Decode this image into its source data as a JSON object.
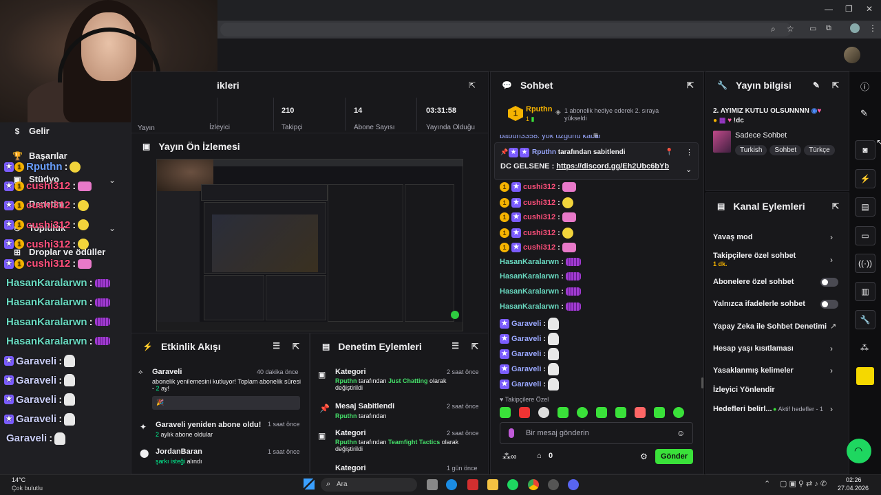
{
  "leftnav": {
    "gelir": "Gelir",
    "basarilar": "Başarılar",
    "studyo": "Stüdyo",
    "denetim": "Denetim",
    "topluluk": "Topluluk",
    "droplar": "Droplar ve ödüller"
  },
  "overlay_chat": [
    {
      "name": "Rputhn",
      "badges": [
        "star",
        "gold"
      ],
      "emote": "em-yellow",
      "color": "#6aa0ff"
    },
    {
      "name": "cushi312",
      "badges": [
        "star",
        "gold"
      ],
      "emote": "em-fish",
      "color": "#ff4f7b"
    },
    {
      "name": "cushi312",
      "badges": [
        "star",
        "gold"
      ],
      "emote": "em-yellow",
      "color": "#ff4f7b"
    },
    {
      "name": "cushi312",
      "badges": [
        "star",
        "gold"
      ],
      "emote": "em-yellow",
      "color": "#ff4f7b"
    },
    {
      "name": "cushi312",
      "badges": [
        "star",
        "gold"
      ],
      "emote": "em-yellow",
      "color": "#ff4f7b"
    },
    {
      "name": "cushi312",
      "badges": [
        "star",
        "gold"
      ],
      "emote": "em-fish",
      "color": "#ff4f7b"
    },
    {
      "name": "HasanKaralarwn",
      "badges": [],
      "emote": "em-grid",
      "color": "#69d9c0"
    },
    {
      "name": "HasanKaralarwn",
      "badges": [],
      "emote": "em-grid",
      "color": "#69d9c0"
    },
    {
      "name": "HasanKaralarwn",
      "badges": [],
      "emote": "em-grid",
      "color": "#69d9c0"
    },
    {
      "name": "HasanKaralarwn",
      "badges": [],
      "emote": "em-grid",
      "color": "#69d9c0"
    },
    {
      "name": "Garaveli",
      "badges": [
        "star"
      ],
      "emote": "em-ghost",
      "color": "#c9cdf5"
    },
    {
      "name": "Garaveli",
      "badges": [
        "star"
      ],
      "emote": "em-ghost",
      "color": "#c9cdf5"
    },
    {
      "name": "Garaveli",
      "badges": [
        "star"
      ],
      "emote": "em-ghost",
      "color": "#c9cdf5"
    },
    {
      "name": "Garaveli",
      "badges": [
        "star"
      ],
      "emote": "em-ghost",
      "color": "#c9cdf5"
    },
    {
      "name": "Garaveli",
      "badges": [],
      "emote": "em-ghost",
      "color": "#c9cdf5"
    }
  ],
  "stats": {
    "title_partial": "ikleri",
    "items": [
      {
        "value": "",
        "label": "Yayın"
      },
      {
        "value": "",
        "label": "İzleyici"
      },
      {
        "value": "210",
        "label": "Takipçi"
      },
      {
        "value": "14",
        "label": "Abone Sayısı"
      },
      {
        "value": "03:31:58",
        "label": "Yayında Olduğu"
      }
    ]
  },
  "preview": {
    "title": "Yayın Ön İzlemesi"
  },
  "activity": {
    "title": "Etkinlik Akışı",
    "items": [
      {
        "name": "Garaveli",
        "time": "40 dakika önce",
        "text": "abonelik yenilemesini kutluyor! Toplam abonelik süresi - ",
        "count": "2",
        "unit": " ay!"
      },
      {
        "name": "Garaveli yeniden abone oldu!",
        "time": "1 saat önce",
        "count": "2",
        "text": " aylık abone oldular"
      },
      {
        "name": "JordanBaran",
        "time": "1 saat önce",
        "link": "şarkı isteği",
        "text": " alındı"
      }
    ]
  },
  "moderation": {
    "title": "Denetim Eylemleri",
    "items": [
      {
        "title": "Kategori",
        "time": "2 saat önce",
        "user": "Rputhn",
        "mid": " tarafından ",
        "target": "Just Chatting",
        "end": " olarak değiştirildi"
      },
      {
        "title": "Mesaj Sabitlendi",
        "time": "2 saat önce",
        "user": "Rputhn",
        "mid": " tarafından",
        "target": "",
        "end": ""
      },
      {
        "title": "Kategori",
        "time": "2 saat önce",
        "user": "Rputhn",
        "mid": " tarafından ",
        "target": "Teamfight Tactics",
        "end": " olarak değiştirildi"
      },
      {
        "title": "Kategori",
        "time": "1 gün önce",
        "user": "",
        "mid": "",
        "target": "",
        "end": ""
      }
    ]
  },
  "chat": {
    "title": "Sohbet",
    "gift_user": "Rputhn",
    "gift_count": "1",
    "gift_text": "1 abonelik hediye ederek 2. sıraya yükseldi",
    "rank": "1",
    "hidden_line": "babun3358: yok uzgunu kacar",
    "pinned_by": "Rputhn",
    "pinned_by_text": " tarafından sabitlendi",
    "pinned_msg_prefix": "DC GELSENE : ",
    "pinned_link": "https://discord.gg/Eh2Ubc6bYb",
    "followers_only": "Takipçilere Özel",
    "input_placeholder": "Bir mesaj gönderin",
    "points": "0",
    "send_label": "Gönder",
    "lines": [
      {
        "name": "cushi312",
        "cls": "pink",
        "emote": "em-fish",
        "badges": true
      },
      {
        "name": "cushi312",
        "cls": "pink",
        "emote": "em-yellow",
        "badges": true
      },
      {
        "name": "cushi312",
        "cls": "pink",
        "emote": "em-fish",
        "badges": true
      },
      {
        "name": "cushi312",
        "cls": "pink",
        "emote": "em-yellow",
        "badges": true
      },
      {
        "name": "cushi312",
        "cls": "pink",
        "emote": "em-fish",
        "badges": true
      },
      {
        "name": "HasanKaralarwn",
        "cls": "teal",
        "emote": "em-grid",
        "badges": false
      },
      {
        "name": "HasanKaralarwn",
        "cls": "teal",
        "emote": "em-grid",
        "badges": false
      },
      {
        "name": "HasanKaralarwn",
        "cls": "teal",
        "emote": "em-grid",
        "badges": false
      },
      {
        "name": "HasanKaralarwn",
        "cls": "teal",
        "emote": "em-grid",
        "badges": false
      },
      {
        "name": "Garaveli",
        "cls": "blueish",
        "emote": "em-ghost",
        "badges": true
      },
      {
        "name": "Garaveli",
        "cls": "blueish",
        "emote": "em-ghost",
        "badges": true
      },
      {
        "name": "Garaveli",
        "cls": "blueish",
        "emote": "em-ghost",
        "badges": true
      },
      {
        "name": "Garaveli",
        "cls": "blueish",
        "emote": "em-ghost",
        "badges": true
      },
      {
        "name": "Garaveli",
        "cls": "blueish",
        "emote": "em-ghost",
        "badges": true
      }
    ]
  },
  "stream_info": {
    "title": "Yayın bilgisi",
    "stream_title": "2. AYIMIZ KUTLU OLSUNNNN",
    "stream_title2": "!dc",
    "category": "Sadece Sohbet",
    "tags": [
      "Turkish",
      "Sohbet",
      "Türkçe"
    ]
  },
  "channel_actions": {
    "title": "Kanal Eylemleri",
    "rows": [
      {
        "label": "Yavaş mod",
        "kind": "chev"
      },
      {
        "label": "Takipçilere özel sohbet",
        "sub": "1 dk.",
        "kind": "chev"
      },
      {
        "label": "Abonelere özel sohbet",
        "kind": "toggle"
      },
      {
        "label": "Yalnızca ifadelerle sohbet",
        "kind": "toggle"
      },
      {
        "label": "Yapay Zeka ile Sohbet Denetimi",
        "kind": "ext"
      },
      {
        "label": "Hesap yaşı kısıtlaması",
        "kind": "chev"
      },
      {
        "label": "Yasaklanmış kelimeler",
        "kind": "chev"
      },
      {
        "label": "İzleyici Yönlendir",
        "kind": "none"
      },
      {
        "label": "Hedefleri belirl...",
        "extra": "Aktif hedefler - 1",
        "kind": "chev"
      }
    ]
  },
  "taskbar": {
    "weather_temp": "14°C",
    "weather_desc": "Çok bulutlu",
    "search": "Ara",
    "time": "02:26",
    "date": "27.04.2026"
  }
}
